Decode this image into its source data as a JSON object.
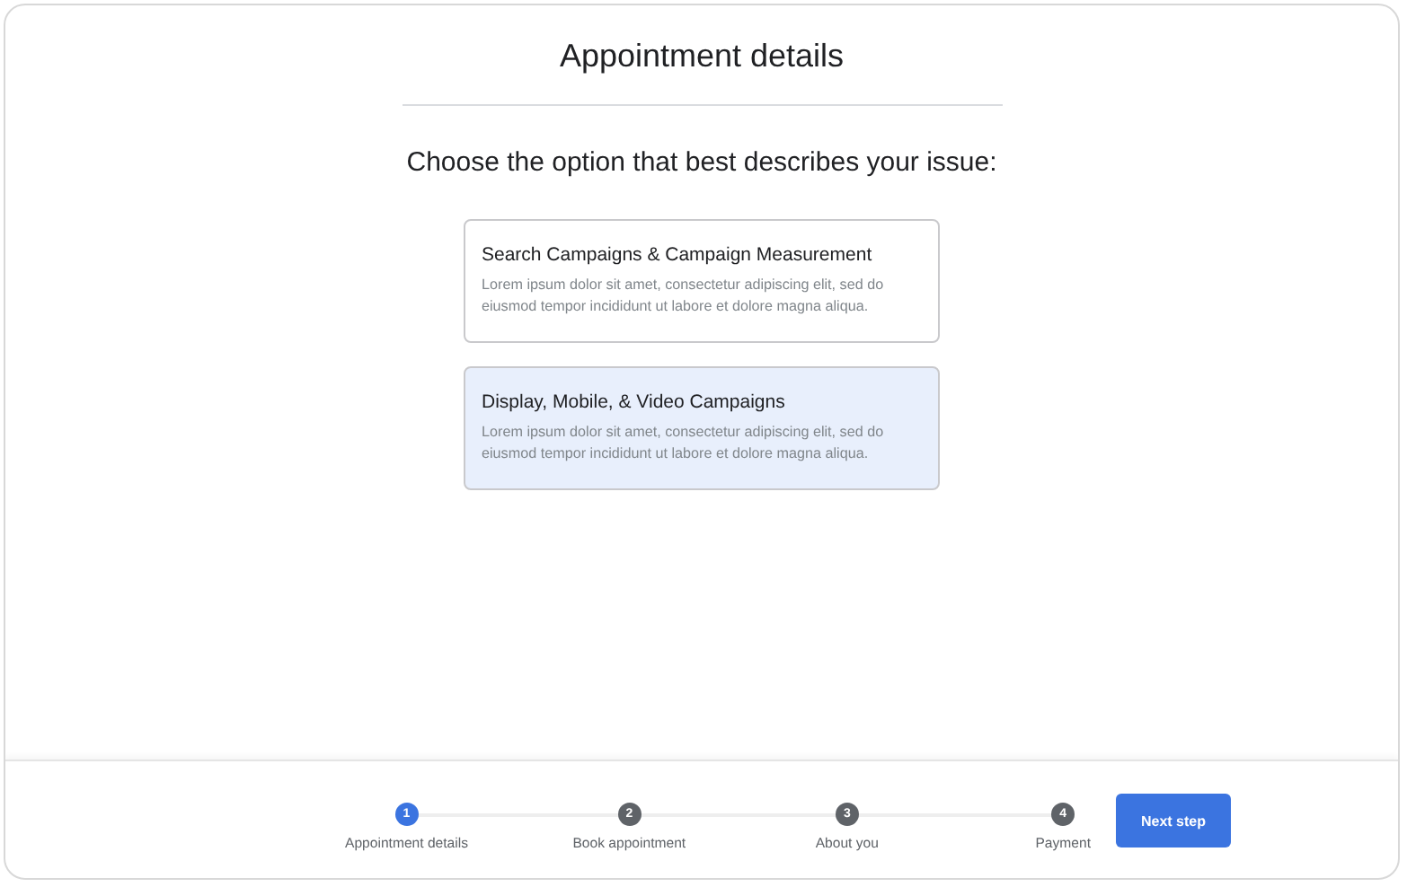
{
  "header": {
    "title": "Appointment details"
  },
  "prompt": "Choose the option that best describes your issue:",
  "options": [
    {
      "title": "Search Campaigns & Campaign Measurement",
      "description": "Lorem ipsum dolor sit amet, consectetur adipiscing elit, sed do eiusmod tempor incididunt ut labore et dolore magna aliqua.",
      "selected": false
    },
    {
      "title": "Display, Mobile, & Video Campaigns",
      "description": "Lorem ipsum dolor sit amet, consectetur adipiscing elit, sed do eiusmod tempor incididunt ut labore et dolore magna aliqua.",
      "selected": true
    }
  ],
  "steps": [
    {
      "number": "1",
      "label": "Appointment details",
      "selected": true
    },
    {
      "number": "2",
      "label": "Book appointment",
      "selected": false
    },
    {
      "number": "3",
      "label": "About you",
      "selected": false
    },
    {
      "number": "4",
      "label": "Payment",
      "selected": false
    }
  ],
  "next_button": "Next step"
}
